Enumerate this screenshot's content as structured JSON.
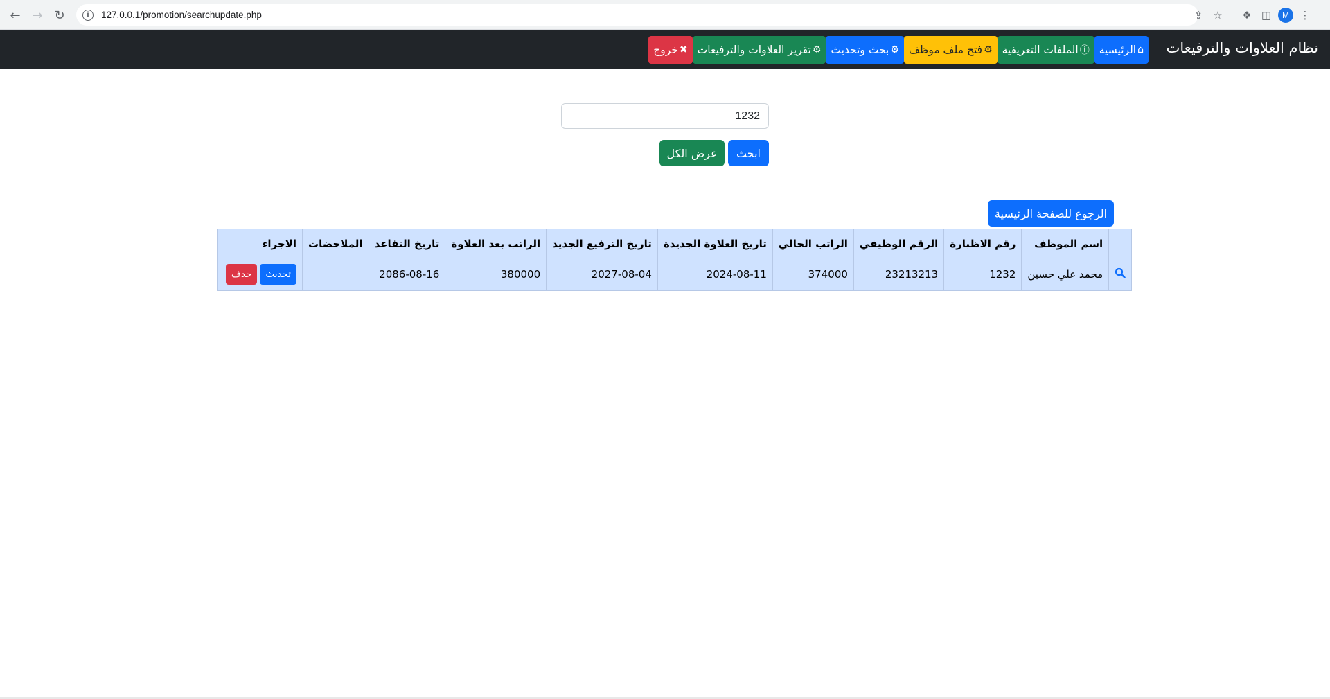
{
  "browser": {
    "url_host": "127.0.0.1",
    "url_path": "/promotion/searchupdate.php",
    "avatar_letter": "M",
    "icons": [
      "back-arrow-icon",
      "forward-arrow-icon",
      "reload-icon",
      "info-icon",
      "share-icon",
      "star-icon",
      "extensions-icon",
      "side-panel-icon"
    ]
  },
  "navbar": {
    "brand": "نظام العلاوات والترفيعات",
    "items": [
      {
        "label": "الرئيسية",
        "icon": "home-icon",
        "color": "#0d6efd"
      },
      {
        "label": "الملفات التعريفية",
        "icon": "info-circle-icon",
        "color": "#198754"
      },
      {
        "label": "فتح ملف موظف",
        "icon": "gears-icon",
        "color": "#ffc107"
      },
      {
        "label": "بحث وتحديث",
        "icon": "gears-icon",
        "color": "#0d6efd"
      },
      {
        "label": "تقرير العلاوات والترفيعات",
        "icon": "gears-icon",
        "color": "#198754"
      },
      {
        "label": "خروج",
        "icon": "close-icon",
        "color": "#dc3545"
      }
    ]
  },
  "search": {
    "value": "1232",
    "search_label": "ابحث",
    "show_all_label": "عرض الكل"
  },
  "back_button_label": "الرجوع للصفحة الرئيسية",
  "table": {
    "headers": [
      "",
      "اسم الموظف",
      "رقم الاظبارة",
      "الرقم الوظيفي",
      "الراتب الحالي",
      "تاريخ العلاوة الجديدة",
      "تاريخ الترفيع الجديد",
      "الراتب بعد العلاوة",
      "تاريخ التقاعد",
      "الملاحضات",
      "الاجراء"
    ],
    "rows": [
      {
        "name": "محمد علي حسين",
        "file_no": "1232",
        "job_no": "23213213",
        "current_salary": "374000",
        "new_bonus_date": "2024-08-11",
        "new_promotion_date": "2027-08-04",
        "salary_after_bonus": "380000",
        "retirement_date": "2086-08-16",
        "notes": "",
        "update_label": "تحديث",
        "delete_label": "حذف"
      }
    ]
  }
}
